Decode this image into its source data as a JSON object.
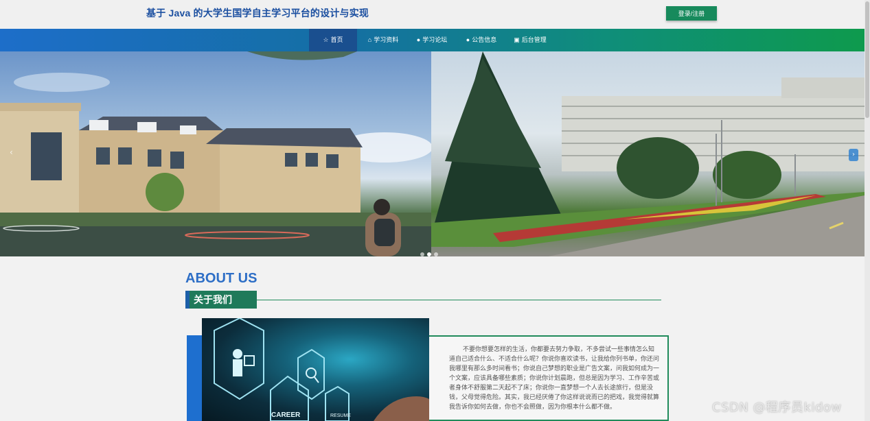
{
  "header": {
    "title": "基于 Java 的大学生国学自主学习平台的设计与实现",
    "login_label": "登录/注册"
  },
  "nav": {
    "items": [
      {
        "icon": "star-icon",
        "label": "首页",
        "active": true
      },
      {
        "icon": "lock-icon",
        "label": "学习资料"
      },
      {
        "icon": "circle-icon",
        "label": "学习论坛"
      },
      {
        "icon": "circle-icon",
        "label": "公告信息"
      },
      {
        "icon": "box-icon",
        "label": "后台管理"
      }
    ]
  },
  "carousel": {
    "slides": [
      {
        "name": "campus-building-slide"
      },
      {
        "name": "campus-road-slide"
      }
    ],
    "dot_count": 3
  },
  "about": {
    "title_en": "ABOUT US",
    "title_cn": "关于我们",
    "text": "不要你想要怎样的生活，你都要去努力争取，不多尝试一些事情怎么知道自己适合什么、不适合什么呢？你说你喜欢读书，让我给你列书单，你还问我哪里有那么多时间看书；你说自己梦想的职业是广告文案，问我如何成为一个文案，应该具备哪些素质；你说你计划晨跑，但总是因为学习、工作辛苦或者身体不舒服第二天起不了床；你说你一直梦想一个人去长途旅行，但是没钱，父母觉得危险。其实，我已经厌倦了你这样说说而已的把戏，我觉得就算我告诉你如何去做，你也不会照做，因为你根本什么都不做。",
    "image_labels": [
      "CAREER",
      "RESUME"
    ]
  },
  "watermark": "CSDN @程序员kidow",
  "colors": {
    "brand_blue": "#1b4fa0",
    "brand_green": "#178a5c",
    "nav_active": "#1a4f8f"
  }
}
